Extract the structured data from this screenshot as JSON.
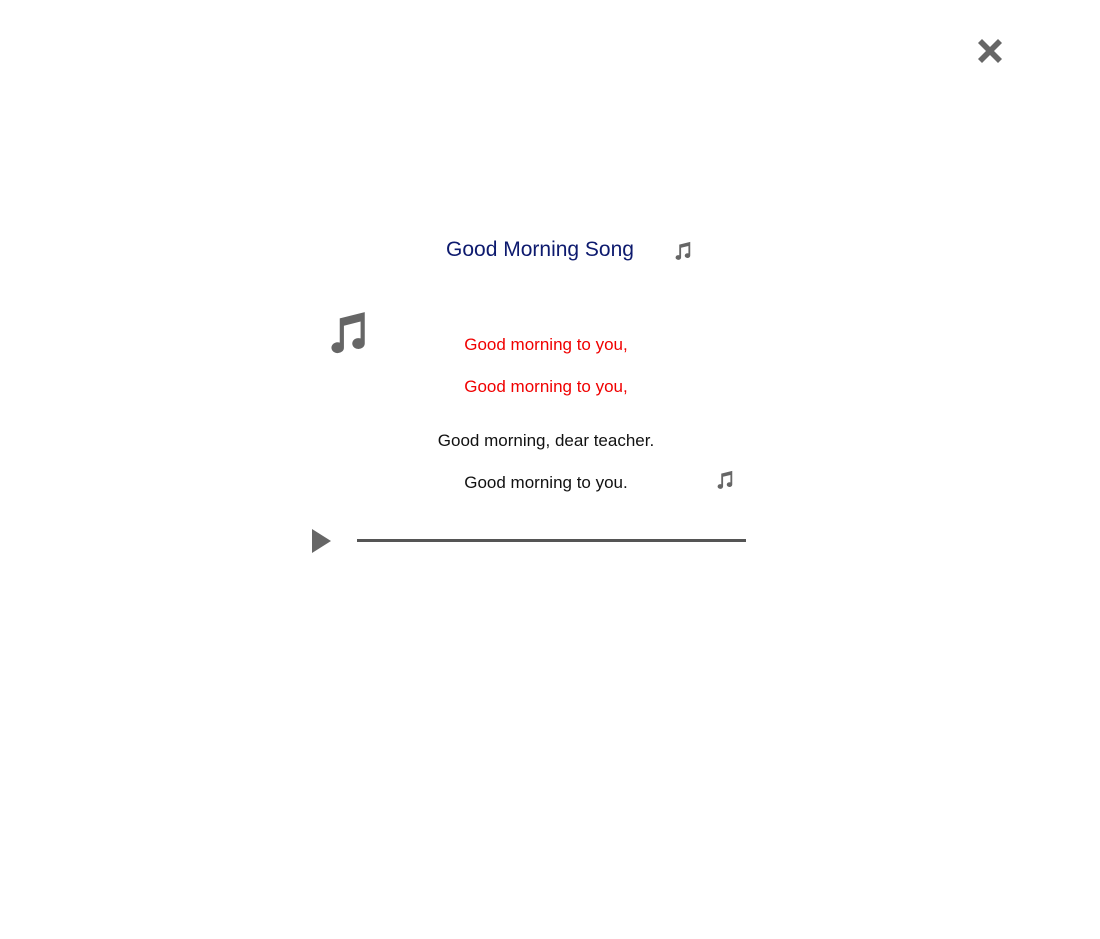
{
  "close": {
    "icon": "close-icon"
  },
  "song": {
    "title": "Good Morning Song",
    "title_icon": "music-note-icon"
  },
  "lyrics": [
    {
      "text": "Good morning to you,",
      "highlighted": true
    },
    {
      "text": "Good morning to you,",
      "highlighted": true
    },
    {
      "text": "Good morning, dear teacher.",
      "highlighted": false
    },
    {
      "text": "Good morning to you.",
      "highlighted": false
    }
  ],
  "player": {
    "play_icon": "play-icon",
    "progress": 1.0
  },
  "colors": {
    "title": "#0d1a6e",
    "highlight": "#f00000",
    "lyric": "#111111",
    "icon": "#666666",
    "track": "#555555"
  },
  "decorations": [
    "music-note-icon",
    "music-note-icon"
  ]
}
